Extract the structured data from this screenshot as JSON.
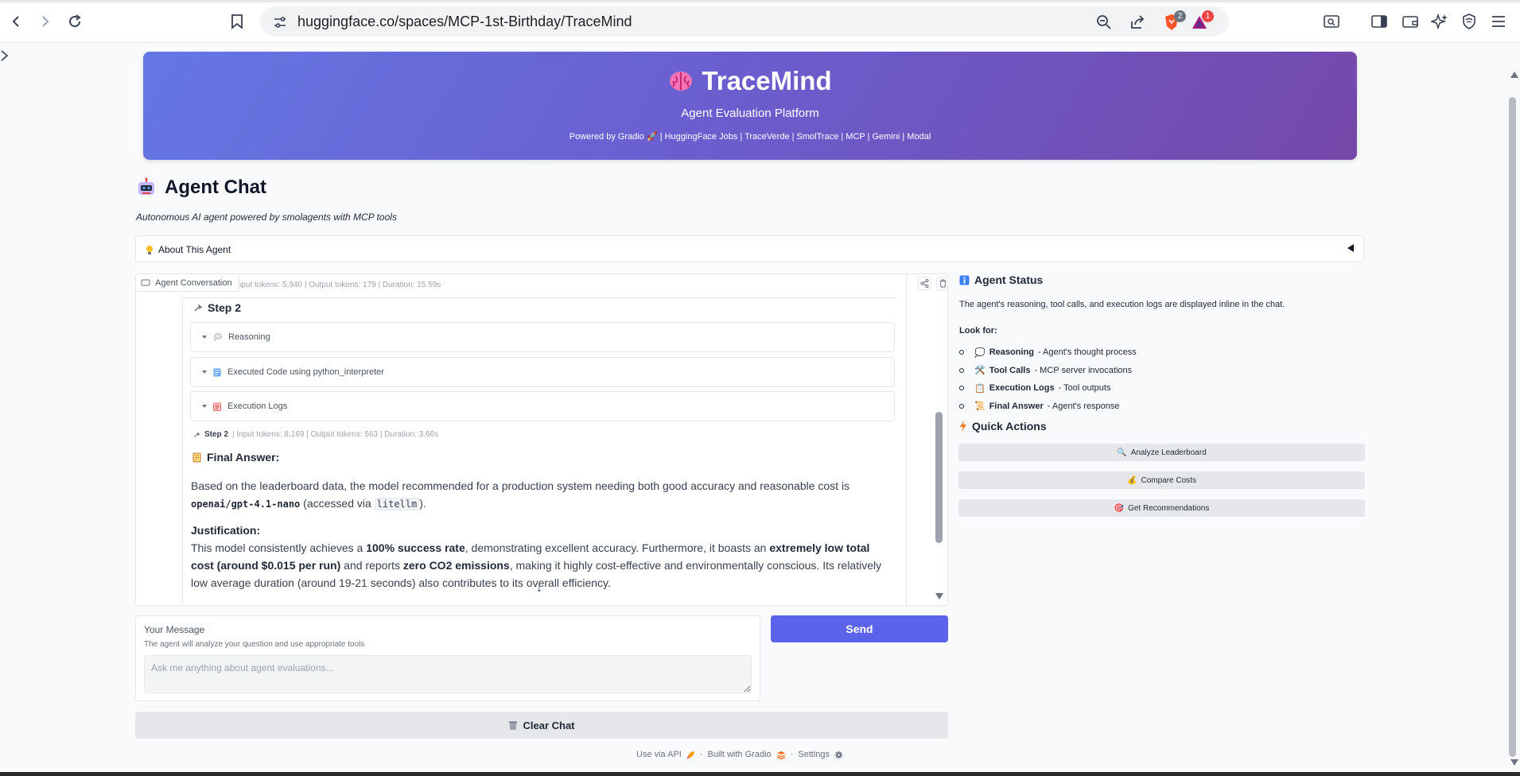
{
  "browser": {
    "url": "huggingface.co/spaces/MCP-1st-Birthday/TraceMind",
    "brave_badge": "2",
    "rewards_badge": "1"
  },
  "header": {
    "title": "TraceMind",
    "subtitle": "Agent Evaluation Platform",
    "powered_by": "Powered by Gradio 🚀 | HuggingFace Jobs | TraceVerde | SmolTrace | MCP | Gemini | Modal"
  },
  "page": {
    "title": "Agent Chat",
    "description": "Autonomous AI agent powered by smolagents with MCP tools",
    "about_label": "About This Agent"
  },
  "chat": {
    "tag": "Agent Conversation",
    "top_meta": "Input tokens: 5,940 | Output tokens: 179 | Duration: 15.59s",
    "step_heading": "Step 2",
    "accordions": [
      "Reasoning",
      "Executed Code using python_interpreter",
      "Execution Logs"
    ],
    "step_meta_label": "Step 2",
    "step_meta": "| Input tokens: 8,169 | Output tokens: 563 | Duration: 3.66s",
    "final_heading": "Final Answer:",
    "answer": {
      "p1_a": "Based on the leaderboard data, the model recommended for a production system needing both good accuracy and reasonable cost is ",
      "p1_model": "openai/gpt-4.1-nano",
      "p1_b": " (accessed via ",
      "p1_lib": "litellm",
      "p1_c": ").",
      "just_heading": "Justification:",
      "p2_a": "This model consistently achieves a ",
      "p2_b1": "100% success rate",
      "p2_c": ", demonstrating excellent accuracy. Furthermore, it boasts an ",
      "p2_b2": "extremely low total cost (around $0.015 per run)",
      "p2_d": " and reports ",
      "p2_b3": "zero CO2 emissions",
      "p2_e": ", making it highly cost-effective and environmentally conscious. Its relatively low average duration (around 19-21 seconds) also contributes to its overall efficiency."
    }
  },
  "input": {
    "label": "Your Message",
    "info": "The agent will analyze your question and use appropriate tools",
    "placeholder": "Ask me anything about agent evaluations...",
    "send_label": "Send",
    "clear_label": "Clear Chat"
  },
  "status": {
    "title": "Agent Status",
    "text": "The agent's reasoning, tool calls, and execution logs are displayed inline in the chat.",
    "look_for": "Look for:",
    "items": [
      {
        "icon": "💭",
        "term": "Reasoning",
        "desc": " - Agent's thought process"
      },
      {
        "icon": "🛠️",
        "term": "Tool Calls",
        "desc": " - MCP server invocations"
      },
      {
        "icon": "📋",
        "term": "Execution Logs",
        "desc": " - Tool outputs"
      },
      {
        "icon": "📜",
        "term": "Final Answer",
        "desc": " - Agent's response"
      }
    ]
  },
  "quick_actions": {
    "title": "Quick Actions",
    "buttons": [
      {
        "icon": "🔍",
        "label": "Analyze Leaderboard"
      },
      {
        "icon": "💰",
        "label": "Compare Costs"
      },
      {
        "icon": "🎯",
        "label": "Get Recommendations"
      }
    ]
  },
  "footer": {
    "api": "Use via API",
    "sep": "·",
    "built": "Built with Gradio",
    "settings": "Settings"
  }
}
